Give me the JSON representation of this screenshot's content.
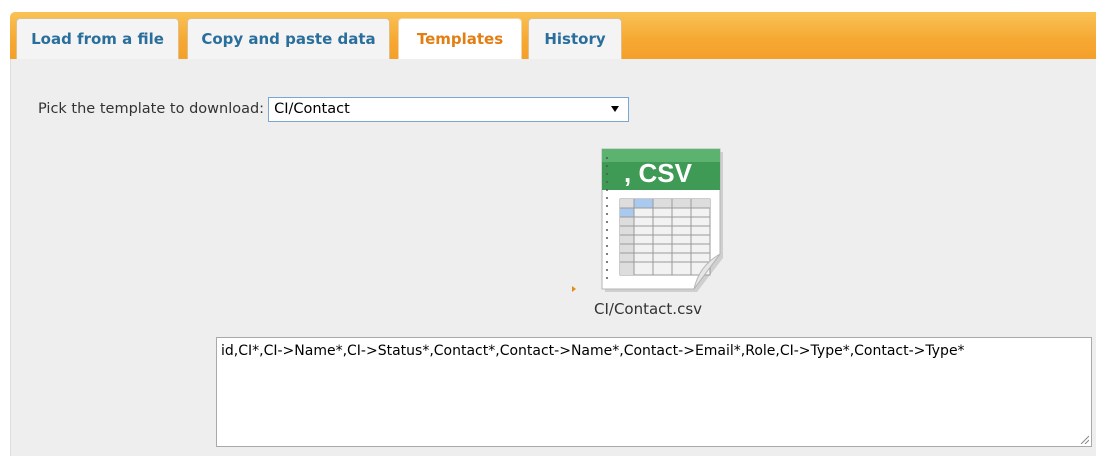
{
  "tabs": [
    {
      "label": "Load from a file",
      "active": false
    },
    {
      "label": "Copy and paste data",
      "active": false
    },
    {
      "label": "Templates",
      "active": true
    },
    {
      "label": "History",
      "active": false
    }
  ],
  "template_picker": {
    "label": "Pick the template to download:",
    "selected": "CI/Contact"
  },
  "csv_file": {
    "icon_text": ", CSV",
    "name": "CI/Contact.csv"
  },
  "template_text": "id,CI*,CI->Name*,CI->Status*,Contact*,Contact->Name*,Contact->Email*,Role,CI->Type*,Contact->Type*",
  "colors": {
    "tabbar": "#f6a832",
    "active_tab_text": "#e37e12",
    "tab_text": "#2a6f9c",
    "csv_green": "#3f9a55"
  }
}
